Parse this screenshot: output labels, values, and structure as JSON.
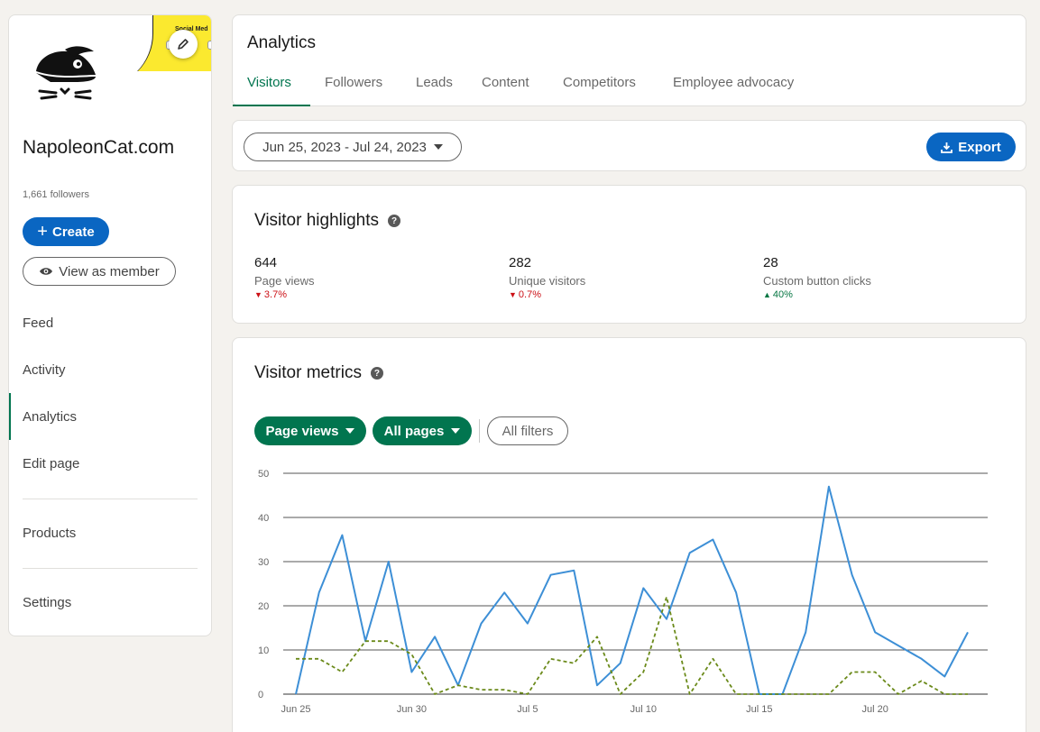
{
  "sidebar": {
    "org_name": "NapoleonCat.com",
    "followers": "1,661 followers",
    "cover_text": "Social Med",
    "create_label": "Create",
    "view_label": "View as member",
    "nav": [
      {
        "label": "Feed"
      },
      {
        "label": "Activity"
      },
      {
        "label": "Analytics",
        "active": true
      },
      {
        "label": "Edit page"
      },
      {
        "label": "Products"
      },
      {
        "label": "Settings"
      }
    ]
  },
  "header": {
    "title": "Analytics",
    "tabs": [
      {
        "label": "Visitors",
        "active": true
      },
      {
        "label": "Followers"
      },
      {
        "label": "Leads"
      },
      {
        "label": "Content"
      },
      {
        "label": "Competitors"
      },
      {
        "label": "Employee advocacy"
      }
    ]
  },
  "date_range": {
    "label": "Jun 25, 2023 - Jul 24, 2023",
    "export_label": "Export"
  },
  "highlights": {
    "title": "Visitor highlights",
    "stats": [
      {
        "value": "644",
        "label": "Page views",
        "change": "3.7%",
        "direction": "down"
      },
      {
        "value": "282",
        "label": "Unique visitors",
        "change": "0.7%",
        "direction": "down"
      },
      {
        "value": "28",
        "label": "Custom button clicks",
        "change": "40%",
        "direction": "up"
      }
    ]
  },
  "metrics": {
    "title": "Visitor metrics",
    "filters": {
      "metric": "Page views",
      "pages": "All pages",
      "all_filters": "All filters"
    }
  },
  "colors": {
    "brand_blue": "#0a66c2",
    "brand_green": "#01754f",
    "series_1": "#3d8fd6",
    "series_2": "#6b8a1a",
    "negative": "#cc1016",
    "positive": "#057642"
  },
  "chart_data": {
    "type": "line",
    "x": [
      "Jun 25",
      "Jun 26",
      "Jun 27",
      "Jun 28",
      "Jun 29",
      "Jun 30",
      "Jul 1",
      "Jul 2",
      "Jul 3",
      "Jul 4",
      "Jul 5",
      "Jul 6",
      "Jul 7",
      "Jul 8",
      "Jul 9",
      "Jul 10",
      "Jul 11",
      "Jul 12",
      "Jul 13",
      "Jul 14",
      "Jul 15",
      "Jul 16",
      "Jul 17",
      "Jul 18",
      "Jul 19",
      "Jul 20",
      "Jul 21",
      "Jul 22",
      "Jul 23",
      "Jul 24"
    ],
    "x_tick_labels": [
      "Jun 25",
      "Jun 30",
      "Jul 5",
      "Jul 10",
      "Jul 15",
      "Jul 20"
    ],
    "series": [
      {
        "style": "solid",
        "color": "#3d8fd6",
        "values": [
          0,
          23,
          36,
          12,
          30,
          5,
          13,
          2,
          16,
          23,
          16,
          27,
          28,
          2,
          7,
          24,
          17,
          32,
          35,
          23,
          0,
          0,
          14,
          47,
          27,
          14,
          11,
          8,
          4,
          14
        ]
      },
      {
        "style": "dashed",
        "color": "#6b8a1a",
        "values": [
          8,
          8,
          5,
          12,
          12,
          9,
          0,
          2,
          1,
          1,
          0,
          8,
          7,
          13,
          0,
          5,
          22,
          0,
          8,
          0,
          0,
          0,
          0,
          0,
          5,
          5,
          0,
          3,
          0,
          0
        ]
      }
    ],
    "ylim": [
      0,
      50
    ],
    "yticks": [
      0,
      10,
      20,
      30,
      40,
      50
    ],
    "grid": true
  }
}
